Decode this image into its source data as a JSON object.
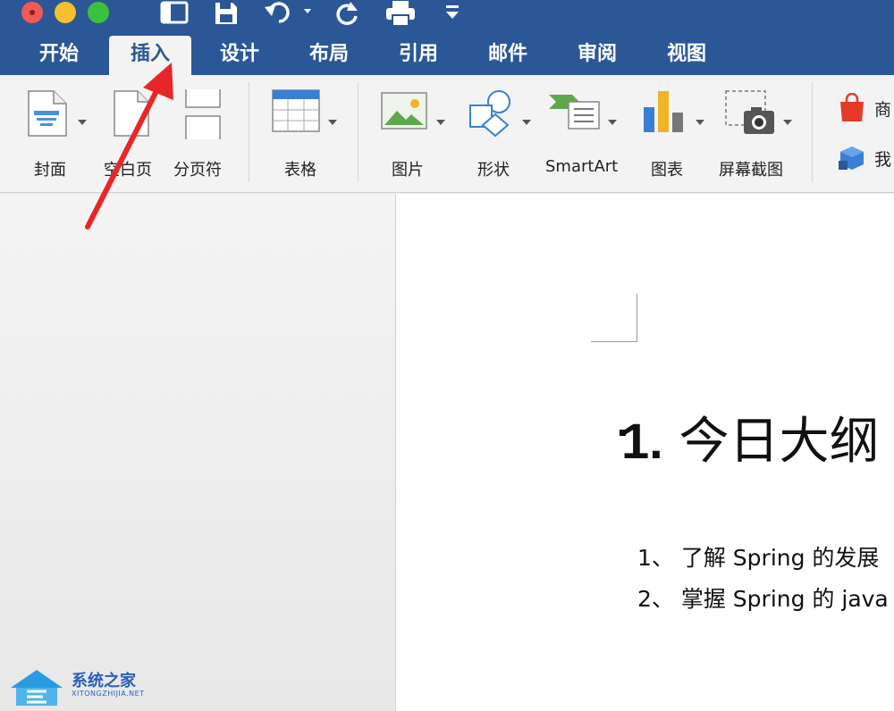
{
  "window": {
    "controls": [
      "close",
      "minimize",
      "zoom"
    ],
    "quick_access": [
      "sidebar-icon",
      "save-icon",
      "undo-icon",
      "redo-icon",
      "print-icon",
      "customize-icon"
    ]
  },
  "tabs": [
    {
      "label": "开始",
      "active": false
    },
    {
      "label": "插入",
      "active": true
    },
    {
      "label": "设计",
      "active": false
    },
    {
      "label": "布局",
      "active": false
    },
    {
      "label": "引用",
      "active": false
    },
    {
      "label": "邮件",
      "active": false
    },
    {
      "label": "审阅",
      "active": false
    },
    {
      "label": "视图",
      "active": false
    }
  ],
  "ribbon": {
    "cover": "封面",
    "blank_page": "空白页",
    "page_break": "分页符",
    "table": "表格",
    "picture": "图片",
    "shapes": "形状",
    "smartart": "SmartArt",
    "chart": "图表",
    "screenshot": "屏幕截图",
    "store_partial": "商",
    "my_addins_partial": "我"
  },
  "document": {
    "heading_number": "1.",
    "heading_text": "今日大纲",
    "lines": [
      "1、 了解 Spring 的发展",
      "2、 掌握 Spring 的 java"
    ]
  },
  "watermark": {
    "title": "系统之家",
    "subtitle": "XITONGZHIJIA.NET"
  },
  "colors": {
    "ribbon_blue": "#2b5797",
    "arrow_red": "#e8262a"
  }
}
